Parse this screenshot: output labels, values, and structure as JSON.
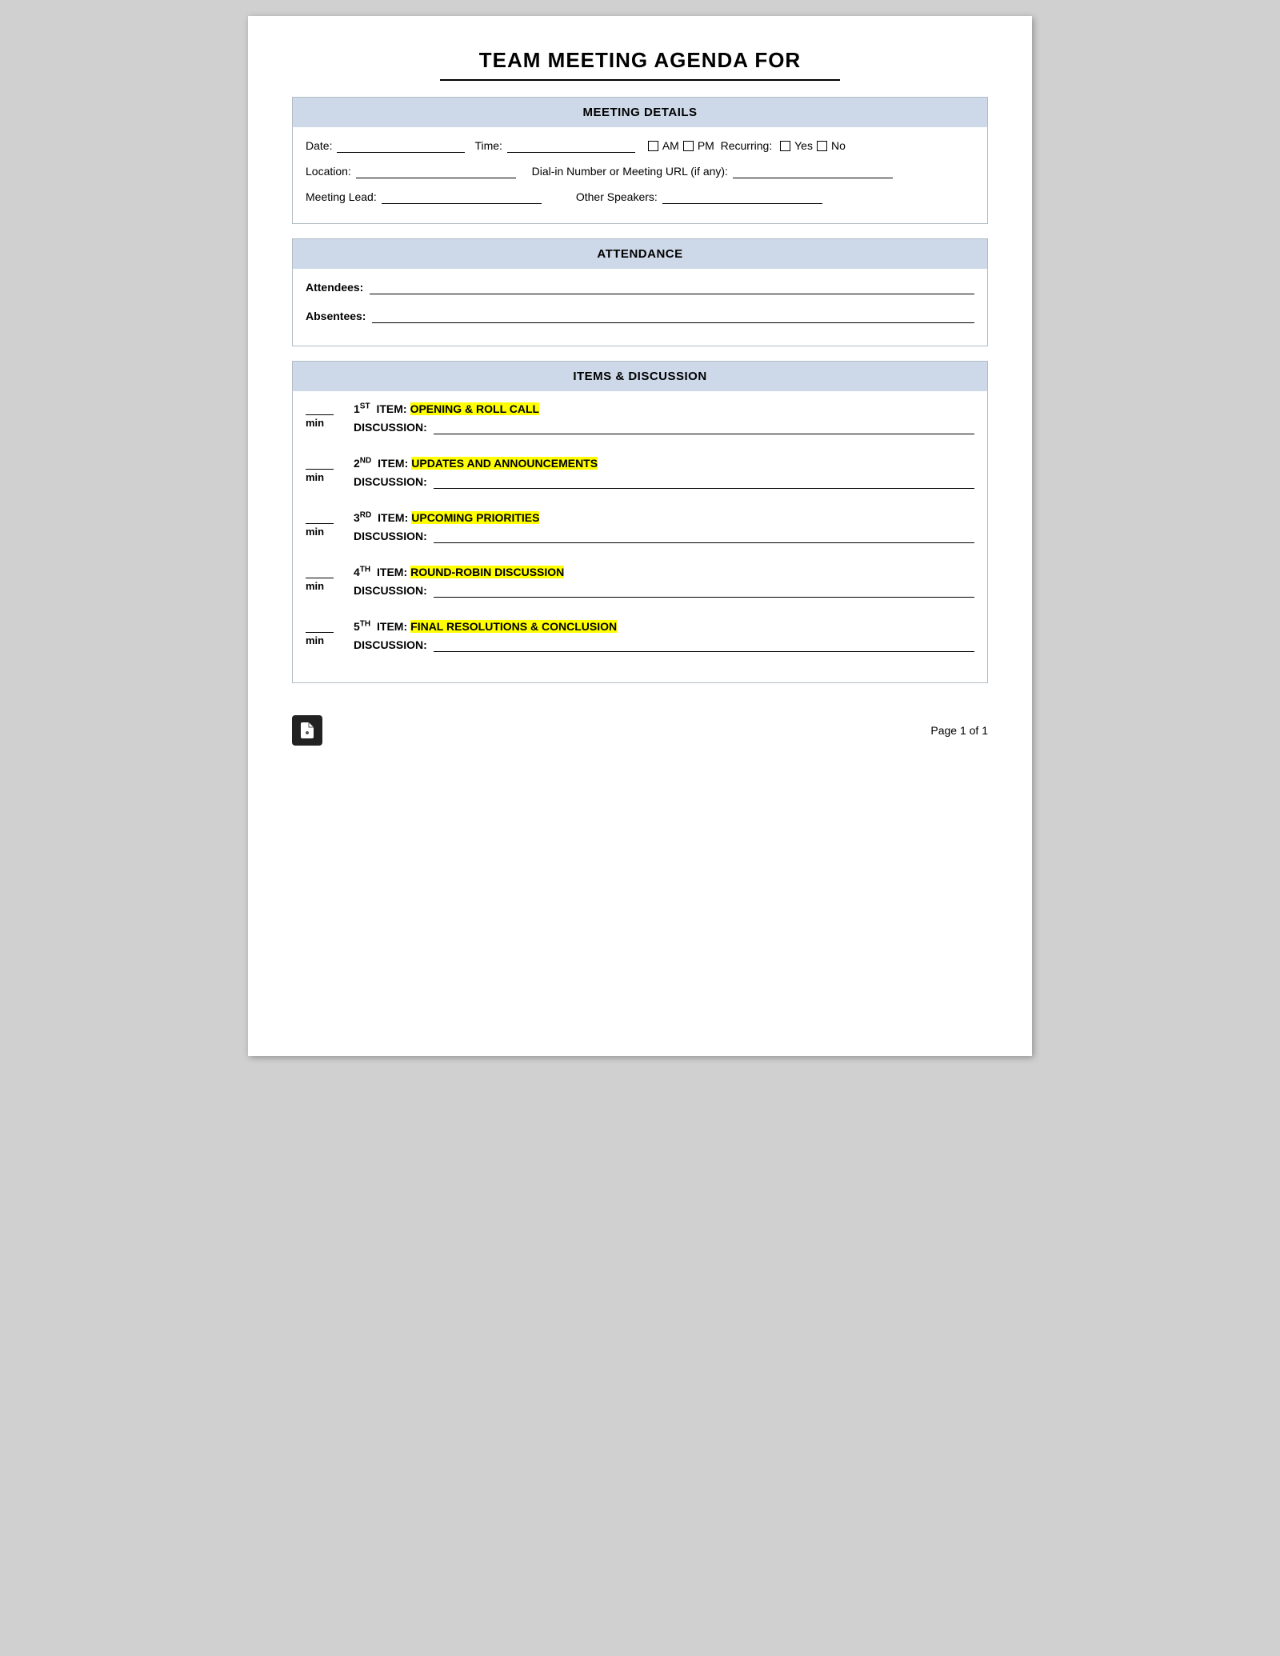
{
  "header": {
    "title": "TEAM MEETING AGENDA FOR"
  },
  "sections": {
    "meeting_details": {
      "label": "MEETING DETAILS",
      "fields": {
        "date_label": "Date:",
        "time_label": "Time:",
        "am_label": "AM",
        "pm_label": "PM",
        "recurring_label": "Recurring:",
        "yes_label": "Yes",
        "no_label": "No",
        "location_label": "Location:",
        "dialin_label": "Dial-in Number or Meeting URL (if any):",
        "meeting_lead_label": "Meeting Lead:",
        "other_speakers_label": "Other Speakers:"
      }
    },
    "attendance": {
      "label": "ATTENDANCE",
      "fields": {
        "attendees_label": "Attendees:",
        "absentees_label": "Absentees:"
      }
    },
    "items": {
      "label": "ITEMS & DISCUSSION",
      "agenda_items": [
        {
          "number": "1",
          "ordinal": "ST",
          "item_label": "ITEM:",
          "name": "OPENING & ROLL CALL",
          "discussion_label": "DISCUSSION:"
        },
        {
          "number": "2",
          "ordinal": "ND",
          "item_label": "ITEM:",
          "name": "UPDATES AND ANNOUNCEMENTS",
          "discussion_label": "DISCUSSION:"
        },
        {
          "number": "3",
          "ordinal": "RD",
          "item_label": "ITEM:",
          "name": "UPCOMING PRIORITIES",
          "discussion_label": "DISCUSSION:"
        },
        {
          "number": "4",
          "ordinal": "TH",
          "item_label": "ITEM:",
          "name": "ROUND-ROBIN DISCUSSION",
          "discussion_label": "DISCUSSION:"
        },
        {
          "number": "5",
          "ordinal": "TH",
          "item_label": "ITEM:",
          "name": "FINAL RESOLUTIONS & CONCLUSION",
          "discussion_label": "DISCUSSION:"
        }
      ]
    }
  },
  "footer": {
    "page_text": "Page 1 of 1",
    "logo_symbol": "ë"
  }
}
